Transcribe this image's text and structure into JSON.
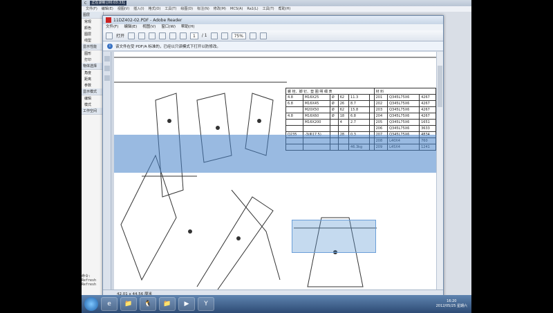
{
  "cad": {
    "title_icon_label": "C",
    "recording_badge": "正在录制 [00:03:33]",
    "menu": [
      "文件(F)",
      "编辑(E)",
      "视图(V)",
      "插入(I)",
      "格式(O)",
      "工具(T)",
      "绘图(D)",
      "标注(N)",
      "修改(M)",
      "MCS(A)",
      "Ra1(L)",
      "工具(T)",
      "帮助(H)"
    ],
    "side_groups": [
      {
        "label": "图层",
        "items": [
          "常规",
          "颜色",
          "图层",
          "线型"
        ]
      },
      {
        "label": "显示性能",
        "items": [
          "图形",
          "打印"
        ]
      },
      {
        "label": "物体选择",
        "items": [
          "角度",
          "距离",
          "参数"
        ]
      },
      {
        "label": "显示模式",
        "items": [
          "编辑",
          "模式"
        ]
      },
      {
        "label": "工作空间",
        "items": []
      }
    ],
    "command_lines": [
      "命令:",
      "Refresh",
      "Refresh"
    ]
  },
  "reader": {
    "title": "11DZ402-02.PDF - Adobe Reader",
    "menu": [
      "文件(F)",
      "编辑(E)",
      "视图(V)",
      "窗口(W)",
      "帮助(H)"
    ],
    "toolbar": {
      "open_label": "打开",
      "page_current": "1",
      "page_total": "/ 1",
      "zoom": "75%"
    },
    "info_bar": "该文件在受 PDF/A 标准的，已经以只读模式下打开以防修改。",
    "status_size": "42.01 x 44.56 厘米"
  },
  "drawing_table": {
    "header": "螺 栓、脚 钉、垫 圈 明 细 表",
    "header_right": "材   料",
    "rows": [
      [
        "4.8",
        "M16X25",
        "Ø",
        "62",
        "11.3",
        "",
        "201",
        "Q345L75X6",
        "4267"
      ],
      [
        "6.8",
        "M16X45",
        "Ø",
        "26",
        "8.7",
        "",
        "202",
        "Q345L75X6",
        "4267"
      ],
      [
        "",
        "M20X50",
        "Ø",
        "62",
        "15.8",
        "",
        "203",
        "Q345L75X6",
        "4267"
      ],
      [
        "4.8",
        "M16X60",
        "Ø",
        "18",
        "6.8",
        "",
        "204",
        "Q345L75X6",
        "4267"
      ],
      [
        "",
        "M16X200",
        "",
        "4",
        "2.7",
        "",
        "205",
        "Q345L75X6",
        "1651"
      ],
      [
        "",
        "",
        "",
        "",
        "",
        "",
        "206",
        "Q345L75X6",
        "3633"
      ],
      [
        "Q235",
        "-3(Φ17.5)",
        "",
        "28",
        "0.3",
        "",
        "207",
        "Q345L75X6",
        "4834"
      ],
      [
        "",
        "",
        "",
        "",
        "",
        "",
        "208",
        "L40X4",
        "760"
      ],
      [
        "",
        "",
        "",
        "",
        "46.3kg",
        "",
        "209",
        "L45X4",
        "1241"
      ]
    ]
  },
  "taskbar": {
    "buttons": [
      "e",
      "📁",
      "🐧",
      "📁",
      "▶",
      "Y"
    ],
    "clock_time": "16:20",
    "clock_date": "2012/05/25 星期六"
  }
}
